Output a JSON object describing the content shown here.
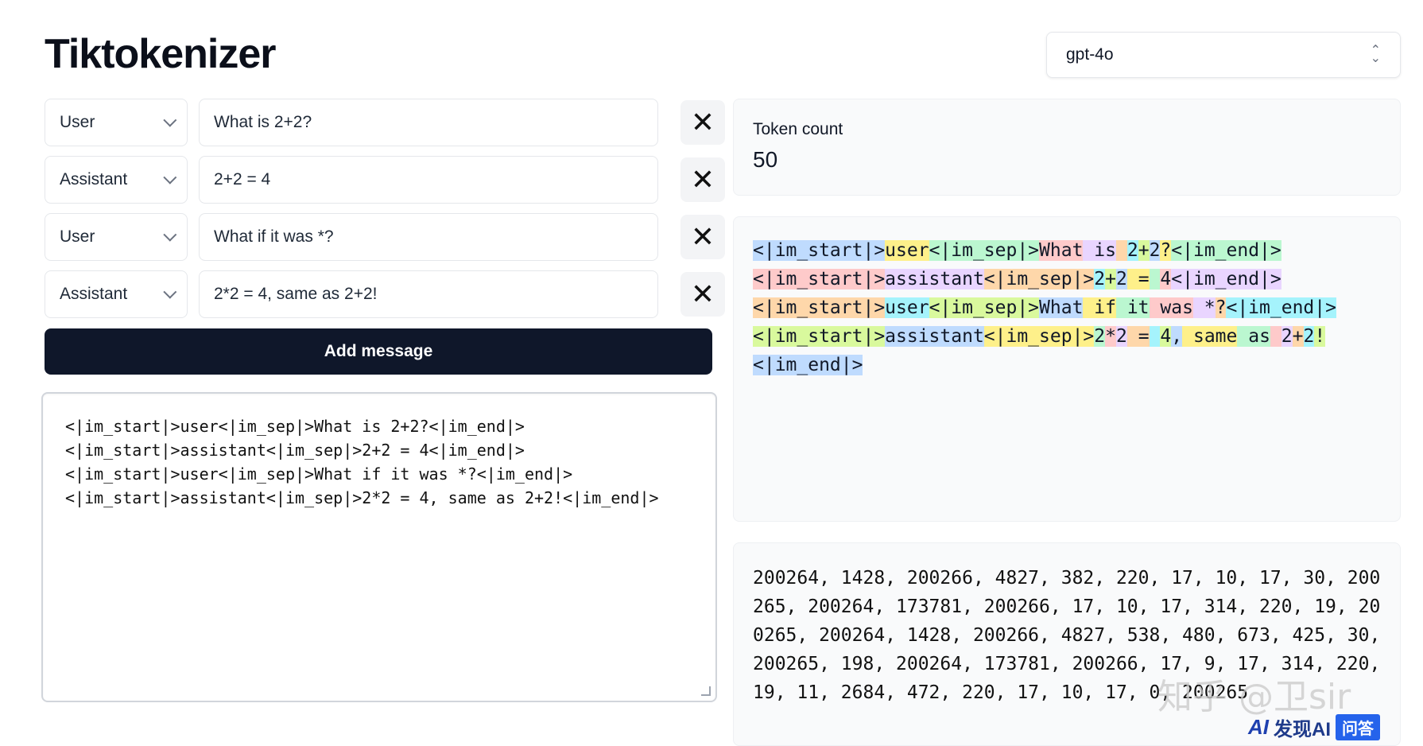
{
  "app": {
    "title": "Tiktokenizer"
  },
  "model": {
    "selected": "gpt-4o"
  },
  "messages": [
    {
      "role": "User",
      "content": "What is 2+2?"
    },
    {
      "role": "Assistant",
      "content": "2+2 = 4"
    },
    {
      "role": "User",
      "content": "What if it was *?"
    },
    {
      "role": "Assistant",
      "content": "2*2 = 4, same as 2+2!"
    }
  ],
  "add_message_label": "Add message",
  "raw_text": [
    "<|im_start|>user<|im_sep|>What is 2+2?<|im_end|>",
    "<|im_start|>assistant<|im_sep|>2+2 = 4<|im_end|>",
    "<|im_start|>user<|im_sep|>What if it was *?<|im_end|>",
    "<|im_start|>assistant<|im_sep|>2*2 = 4, same as 2+2!<|im_end|>"
  ],
  "token_count": {
    "label": "Token count",
    "value": "50"
  },
  "token_colors": [
    "#bfdbfe",
    "#fef08a",
    "#bbf7d0",
    "#fecaca",
    "#e9d5ff",
    "#fed7aa",
    "#a5f3fc",
    "#d9f99d"
  ],
  "tokens": [
    "<|im_start|>",
    "user",
    "<|im_sep|>",
    "What",
    " is",
    " ",
    "2",
    "+",
    "2",
    "?",
    "<|im_end|>",
    "<|im_start|>",
    "assistant",
    "<|im_sep|>",
    "2",
    "+",
    "2",
    " =",
    " ",
    "4",
    "<|im_end|>",
    "<|im_start|>",
    "user",
    "<|im_sep|>",
    "What",
    " if",
    " it",
    " was",
    " *",
    "?",
    "<|im_end|>",
    "<|im_start|>",
    "assistant",
    "<|im_sep|>",
    "2",
    "*",
    "2",
    " =",
    " ",
    "4",
    ",",
    " same",
    " as",
    " ",
    "2",
    "+",
    "2",
    "!",
    "<|im_end|>"
  ],
  "token_ids_text": "200264, 1428, 200266, 4827, 382, 220, 17, 10, 17, 30, 200265, 200264, 173781, 200266, 17, 10, 17, 314, 220, 19, 200265, 200264, 1428, 200266, 4827, 538, 480, 673, 425, 30, 200265, 198, 200264, 173781, 200266, 17, 9, 17, 314, 220, 19, 11, 2684, 472, 220, 17, 10, 17, 0, 200265",
  "watermark": "知乎 @卫sir",
  "logo": {
    "mark": "AI",
    "text": "发现AI",
    "badge": "问答"
  }
}
